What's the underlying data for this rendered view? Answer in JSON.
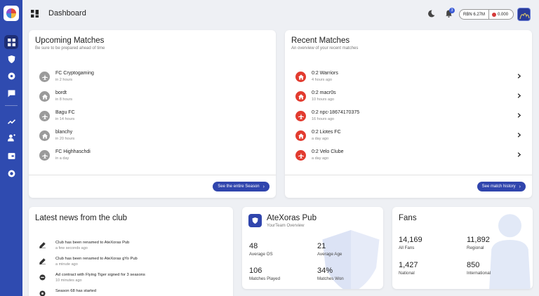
{
  "header": {
    "title": "Dashboard",
    "notification_count": "3",
    "rbn_balance": "RBN 6.27M",
    "coin_balance": "0.000"
  },
  "sidebar": {
    "items": [
      {
        "icon": "dashboard-icon",
        "active": true
      },
      {
        "icon": "shield-icon",
        "active": false
      },
      {
        "icon": "soccer-ball-icon",
        "active": false
      },
      {
        "icon": "chat-icon",
        "active": false
      },
      {
        "icon": "trending-icon",
        "active": false
      },
      {
        "icon": "user-add-icon",
        "active": false
      },
      {
        "icon": "wallet-icon",
        "active": false
      },
      {
        "icon": "record-icon",
        "active": false
      }
    ]
  },
  "upcoming": {
    "title": "Upcoming Matches",
    "subtitle": "Be sure to be prepared ahead of time",
    "matches": [
      {
        "name": "FC Cryptogaming",
        "time": "in 2 hours",
        "venue": "away"
      },
      {
        "name": "bordt",
        "time": "in 8 hours",
        "venue": "home"
      },
      {
        "name": "Bagu FC",
        "time": "in 14 hours",
        "venue": "away"
      },
      {
        "name": "blanchy",
        "time": "in 20 hours",
        "venue": "home"
      },
      {
        "name": "FC Highhaschdi",
        "time": "in a day",
        "venue": "away"
      }
    ],
    "button": "See the entire Season"
  },
  "recent": {
    "title": "Recent Matches",
    "subtitle": "An overview of your recent matches",
    "matches": [
      {
        "name": "0:2 Warriors",
        "time": "4 hours ago",
        "venue": "home"
      },
      {
        "name": "0:2 macr0s",
        "time": "10 hours ago",
        "venue": "home"
      },
      {
        "name": "0:2 npc-18674170375",
        "time": "16 hours ago",
        "venue": "away"
      },
      {
        "name": "0:2 Liotes FC",
        "time": "a day ago",
        "venue": "home"
      },
      {
        "name": "0:2 Velo Clube",
        "time": "a day ago",
        "venue": "away"
      }
    ],
    "button": "See match history"
  },
  "news": {
    "title": "Latest news from the club",
    "items": [
      {
        "text": "Club has been renamed to AteXoras Pub",
        "time": "a few seconds ago",
        "icon": "pencil-icon"
      },
      {
        "text": "Club has been renamed to AteXoras gYo Pub",
        "time": "a minute ago",
        "icon": "pencil-icon"
      },
      {
        "text": "Ad contract with Flying Tiger signed for 3 seasons",
        "time": "10 minutes ago",
        "icon": "contract-icon"
      },
      {
        "text": "Season 68 has started",
        "time": "",
        "icon": "soccer-ball-icon"
      }
    ]
  },
  "team": {
    "title": "AteXoras Pub",
    "subtitle": "YourTeam Overview",
    "stats": [
      {
        "value": "48",
        "label": "Average OS"
      },
      {
        "value": "21",
        "label": "Average Age"
      },
      {
        "value": "106",
        "label": "Matches Played"
      },
      {
        "value": "34%",
        "label": "Matches Won"
      }
    ]
  },
  "fans": {
    "title": "Fans",
    "stats": [
      {
        "value": "14,169",
        "label": "All Fans"
      },
      {
        "value": "11,892",
        "label": "Regional"
      },
      {
        "value": "1,427",
        "label": "National"
      },
      {
        "value": "850",
        "label": "International"
      }
    ]
  },
  "colors": {
    "sidebar": "#2f4bb0",
    "primary_button": "#3045ad",
    "home_icon_red": "#e23b2f",
    "neutral_icon": "#9b9b9b"
  }
}
